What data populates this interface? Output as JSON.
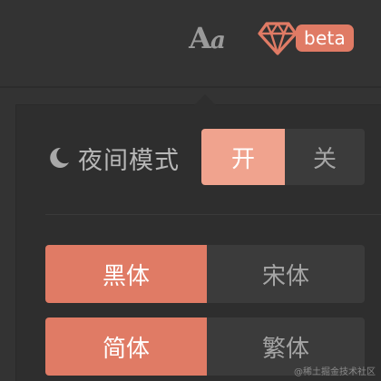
{
  "toolbar": {
    "font_button": {
      "big": "A",
      "small": "a",
      "icon": "font-settings-icon"
    },
    "gem_icon": "gem-icon",
    "beta_badge": "beta"
  },
  "settings_panel": {
    "night_mode": {
      "icon": "moon-icon",
      "label": "夜间模式",
      "on_label": "开",
      "off_label": "关",
      "selected": "on"
    },
    "font_face": {
      "options": [
        "黑体",
        "宋体"
      ],
      "selected": "黑体"
    },
    "script": {
      "options": [
        "简体",
        "繁体"
      ],
      "selected": "简体"
    }
  },
  "watermark": "@稀土掘金技术社区",
  "colors": {
    "background": "#333333",
    "panel": "#2e2e2e",
    "accent": "#e07b65",
    "accent_light": "#f0a38e",
    "inactive_option": "#3b3b3b",
    "muted_text": "#a5a5a5"
  }
}
